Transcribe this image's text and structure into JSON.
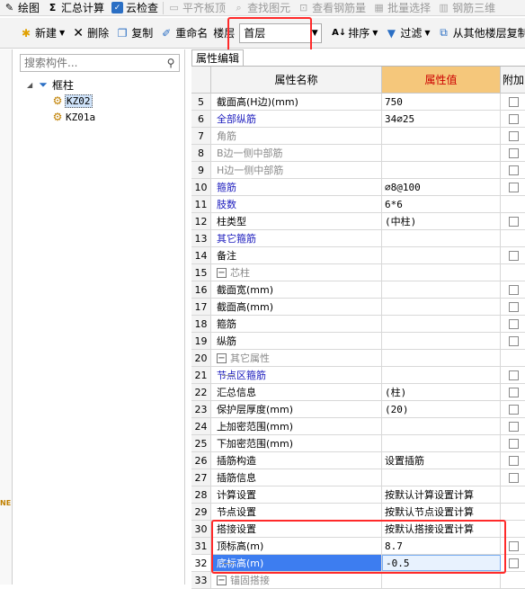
{
  "toolbar1": {
    "items": [
      {
        "label": "绘图",
        "icon": "pencil-icon",
        "disabled": false
      },
      {
        "label": "汇总计算",
        "icon": "sigma-icon",
        "disabled": false
      },
      {
        "label": "云检查",
        "icon": "check-icon",
        "disabled": false
      },
      {
        "label": "平齐板顶",
        "icon": "align-icon",
        "disabled": true
      },
      {
        "label": "查找图元",
        "icon": "find-icon",
        "disabled": true
      },
      {
        "label": "查看钢筋量",
        "icon": "view-icon",
        "disabled": true
      },
      {
        "label": "批量选择",
        "icon": "select-icon",
        "disabled": true
      },
      {
        "label": "钢筋三维",
        "icon": "cube-icon",
        "disabled": true
      }
    ]
  },
  "toolbar2": {
    "new_label": "新建",
    "delete_label": "删除",
    "copy_label": "复制",
    "rename_label": "重命名",
    "floor_label": "楼层",
    "floor_value": "首层",
    "sort_label": "排序",
    "filter_label": "过滤",
    "copy_from_label": "从其他楼层复制"
  },
  "left_strip": {
    "mark": "NE"
  },
  "tree_panel": {
    "search_placeholder": "搜索构件...",
    "root_label": "框柱",
    "items": [
      {
        "label": "KZ02",
        "selected": true
      },
      {
        "label": "KZ01a",
        "selected": false
      }
    ]
  },
  "prop_panel": {
    "tab_label": "属性编辑",
    "header": {
      "num": "",
      "name": "属性名称",
      "value": "属性值",
      "add": "附加"
    },
    "rows": [
      {
        "num": "5",
        "name": "截面高(H边)(mm)",
        "value": "750",
        "style": "black",
        "level": 0,
        "checkbox": true
      },
      {
        "num": "6",
        "name": "全部纵筋",
        "value": "34⌀25",
        "style": "blue",
        "level": 0,
        "checkbox": true
      },
      {
        "num": "7",
        "name": "角筋",
        "value": "",
        "style": "gray",
        "level": 0,
        "checkbox": true
      },
      {
        "num": "8",
        "name": "B边一侧中部筋",
        "value": "",
        "style": "gray",
        "level": 0,
        "checkbox": true
      },
      {
        "num": "9",
        "name": "H边一侧中部筋",
        "value": "",
        "style": "gray",
        "level": 0,
        "checkbox": true
      },
      {
        "num": "10",
        "name": "箍筋",
        "value": "⌀8@100",
        "style": "blue",
        "level": 0,
        "checkbox": true
      },
      {
        "num": "11",
        "name": "肢数",
        "value": "6*6",
        "style": "blue",
        "level": 0,
        "checkbox": false
      },
      {
        "num": "12",
        "name": "柱类型",
        "value": "(中柱)",
        "style": "black",
        "level": 0,
        "checkbox": true
      },
      {
        "num": "13",
        "name": "其它箍筋",
        "value": "",
        "style": "blue",
        "level": 0,
        "checkbox": false
      },
      {
        "num": "14",
        "name": "备注",
        "value": "",
        "style": "black",
        "level": 0,
        "checkbox": true
      },
      {
        "num": "15",
        "name": "芯柱",
        "value": "",
        "style": "gray",
        "level": -1,
        "checkbox": false
      },
      {
        "num": "16",
        "name": "截面宽(mm)",
        "value": "",
        "style": "black",
        "level": 1,
        "checkbox": true
      },
      {
        "num": "17",
        "name": "截面高(mm)",
        "value": "",
        "style": "black",
        "level": 1,
        "checkbox": true
      },
      {
        "num": "18",
        "name": "箍筋",
        "value": "",
        "style": "black",
        "level": 1,
        "checkbox": true
      },
      {
        "num": "19",
        "name": "纵筋",
        "value": "",
        "style": "black",
        "level": 1,
        "checkbox": true
      },
      {
        "num": "20",
        "name": "其它属性",
        "value": "",
        "style": "gray",
        "level": -1,
        "checkbox": false
      },
      {
        "num": "21",
        "name": "节点区箍筋",
        "value": "",
        "style": "blue",
        "level": 1,
        "checkbox": true
      },
      {
        "num": "22",
        "name": "汇总信息",
        "value": "(柱)",
        "style": "black",
        "level": 1,
        "checkbox": true
      },
      {
        "num": "23",
        "name": "保护层厚度(mm)",
        "value": "(20)",
        "style": "black",
        "level": 1,
        "checkbox": true
      },
      {
        "num": "24",
        "name": "上加密范围(mm)",
        "value": "",
        "style": "black",
        "level": 1,
        "checkbox": true
      },
      {
        "num": "25",
        "name": "下加密范围(mm)",
        "value": "",
        "style": "black",
        "level": 1,
        "checkbox": true
      },
      {
        "num": "26",
        "name": "插筋构造",
        "value": "设置插筋",
        "style": "black",
        "level": 1,
        "checkbox": true
      },
      {
        "num": "27",
        "name": "插筋信息",
        "value": "",
        "style": "black",
        "level": 1,
        "checkbox": true
      },
      {
        "num": "28",
        "name": "计算设置",
        "value": "按默认计算设置计算",
        "style": "black",
        "level": 1,
        "checkbox": false
      },
      {
        "num": "29",
        "name": "节点设置",
        "value": "按默认节点设置计算",
        "style": "black",
        "level": 1,
        "checkbox": false
      },
      {
        "num": "30",
        "name": "搭接设置",
        "value": "按默认搭接设置计算",
        "style": "black",
        "level": 1,
        "checkbox": false
      },
      {
        "num": "31",
        "name": "顶标高(m)",
        "value": "8.7",
        "style": "black",
        "level": 1,
        "checkbox": true
      },
      {
        "num": "32",
        "name": "底标高(m)",
        "value": "-0.5",
        "style": "black",
        "level": 1,
        "checkbox": true,
        "selected": true
      },
      {
        "num": "33",
        "name": "锚固搭接",
        "value": "",
        "style": "gray",
        "level": -1,
        "checkbox": false
      }
    ]
  },
  "colors": {
    "accent": "#3d7df0",
    "header_value_bg": "#f5c77b",
    "highlight_box": "#ff2a2a",
    "link_blue": "#1b1bbd"
  }
}
